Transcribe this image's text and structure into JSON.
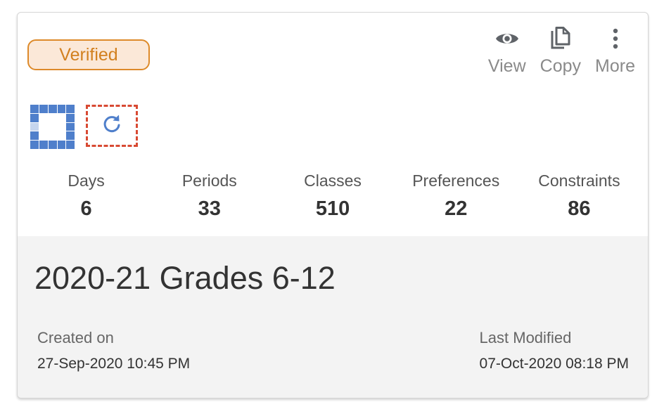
{
  "badge": {
    "label": "Verified",
    "color": "#d2801f"
  },
  "actions": [
    {
      "label": "View",
      "icon": "eye-icon"
    },
    {
      "label": "Copy",
      "icon": "copy-icon"
    },
    {
      "label": "More",
      "icon": "more-vertical-icon"
    }
  ],
  "icons": {
    "grid": "grid-pattern-icon",
    "refresh": "refresh-icon"
  },
  "stats": [
    {
      "label": "Days",
      "value": "6"
    },
    {
      "label": "Periods",
      "value": "33"
    },
    {
      "label": "Classes",
      "value": "510"
    },
    {
      "label": "Preferences",
      "value": "22"
    },
    {
      "label": "Constraints",
      "value": "86"
    }
  ],
  "schedule": {
    "title": "2020-21 Grades 6-12",
    "created_label": "Created on",
    "created_value": "27-Sep-2020 10:45 PM",
    "modified_label": "Last Modified",
    "modified_value": "07-Oct-2020 08:18 PM"
  },
  "colors": {
    "accent": "#4f7fcb",
    "badge_bg": "#fbe8d8",
    "dashed_border": "#d84a33"
  }
}
